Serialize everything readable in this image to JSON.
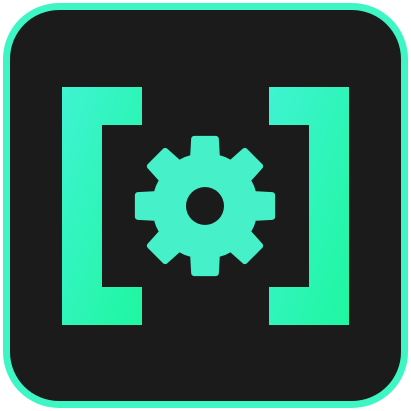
{
  "icon": {
    "name": "settings-brackets-app-icon",
    "frame_color": "#3ef5c4",
    "background_color": "#1b1b1b",
    "accent_gradient_start": "#3ff3d2",
    "accent_gradient_end": "#1ef7a0",
    "gear_color": "#46f0c8",
    "gear_hole_color": "#1b1b1b",
    "glyphs": [
      "bracket-left-icon",
      "gear-icon",
      "bracket-right-icon"
    ]
  }
}
